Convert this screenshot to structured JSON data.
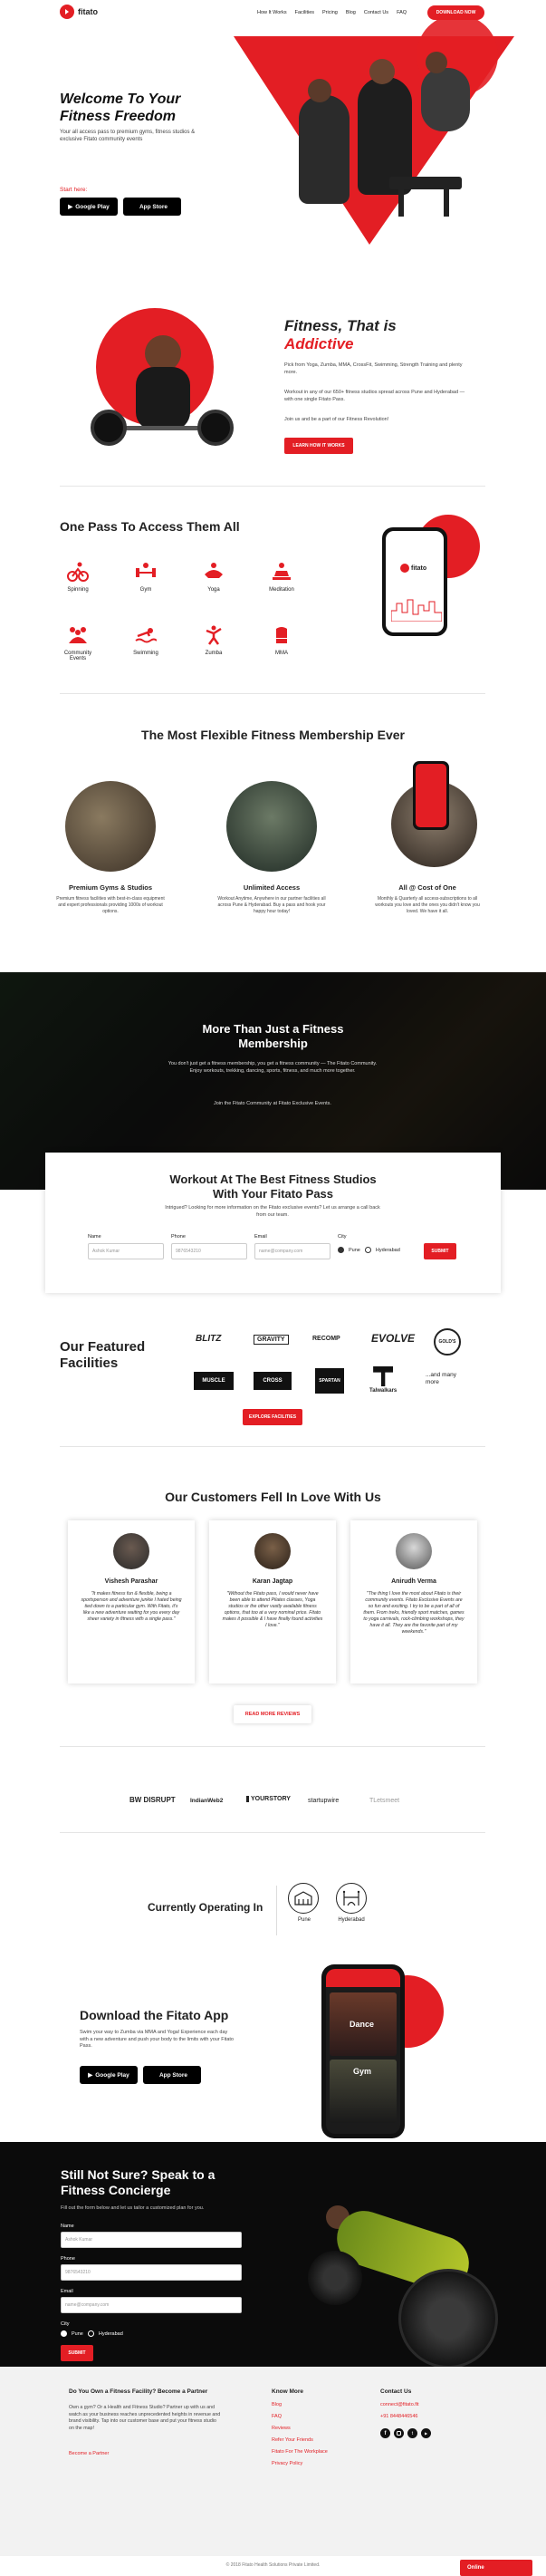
{
  "nav": {
    "brand": "fitato",
    "links": [
      "How It Works",
      "Facilities",
      "Pricing",
      "Blog",
      "Contact Us",
      "FAQ"
    ],
    "cta": "DOWNLOAD NOW"
  },
  "hero": {
    "title_line1": "Welcome To Your",
    "title_line2": "Fitness Freedom",
    "subtitle": "Your all access pass to premium gyms, fitness studios & exclusive Fitato community events",
    "start_here": "Start here:",
    "google_play": "Google Play",
    "app_store": "App Store"
  },
  "addictive": {
    "title_line1": "Fitness, That is",
    "title_line2": "Addictive",
    "p1": "Pick from Yoga, Zumba, MMA, CrossFit, Swimming, Strength Training and plenty more.",
    "p2": "Workout in any of our 650+ fitness studios spread across Pune and Hyderabad — with one single Fitato Pass.",
    "p3": "Join us and be a part of our Fitness Revolution!",
    "cta": "LEARN HOW IT WORKS"
  },
  "onepass": {
    "title": "One Pass To Access Them All",
    "activities": [
      "Spinning",
      "Gym",
      "Yoga",
      "Meditation",
      "Community Events",
      "Swimming",
      "Zumba",
      "MMA"
    ]
  },
  "flexible": {
    "title": "The Most Flexible Fitness Membership Ever",
    "cols": [
      {
        "title": "Premium Gyms & Studios",
        "text": "Premium fitness facilities with best-in-class equipment and expert professionals providing 1000s of workout options."
      },
      {
        "title": "Unlimited Access",
        "text": "Workout Anytime, Anywhere in our partner facilities all across Pune & Hyderabad. Buy a pass and hook your happy hour today!"
      },
      {
        "title": "All @ Cost of One",
        "text": "Monthly & Quarterly all access-subscriptions to all workouts you love and the ones you didn't know you loved. We have it all."
      }
    ]
  },
  "membership": {
    "title_line1": "More Than Just a Fitness",
    "title_line2": "Membership",
    "text": "You don't just get a fitness membership, you get a fitness community — The Fitato Community. Enjoy workouts, trekking, dancing, sports, fitness, and much more together.",
    "text2": "Join the Fitato Community at Fitato Exclusive Events."
  },
  "form1": {
    "title_line1": "Workout At The Best Fitness Studios",
    "title_line2": "With Your Fitato Pass",
    "subtitle": "Intrigued? Looking for more information on the Fitato exclusive events? Let us arrange a call back from our team.",
    "name_label": "Name",
    "name_ph": "Ashok Kumar",
    "phone_label": "Phone",
    "phone_ph": "9876543210",
    "email_label": "Email",
    "email_ph": "name@company.com",
    "city_label": "City",
    "city1": "Pune",
    "city2": "Hyderabad",
    "submit": "SUBMIT"
  },
  "facilities": {
    "title_line1": "Our Featured",
    "title_line2": "Facilities",
    "logos": [
      "BLITZ",
      "GRAVITY",
      "RECOMP",
      "EVOLVE",
      "GOLD'S",
      "MUSCLE",
      "CROSS",
      "SPARTAN",
      "Talwalkars"
    ],
    "more": "...and many more",
    "cta": "EXPLORE FACILITIES"
  },
  "reviews": {
    "title": "Our Customers Fell In Love With Us",
    "items": [
      {
        "name": "Vishesh Parashar",
        "text": "\"It makes fitness fun & flexible, being a sportsperson and adventure junkie I hated being tied down to a particular gym. With Fitato, it's like a new adventure waiting for you every day sheer variety in fitness with a single pass.\""
      },
      {
        "name": "Karan Jagtap",
        "text": "\"Without the Fitato pass, I would never have been able to attend Pilates classes, Yoga studios or the other vastly available fitness options, that too at a very nominal price. Fitato makes it possible & I have finally found activities I love.\""
      },
      {
        "name": "Anirudh Verma",
        "text": "\"The thing I love the most about Fitato is their community events. Fitato Exclusive Events are so fun and exciting. I try to be a part of all of them. From treks, friendly sport matches, games to yoga carnivals, rock-climbing workshops, they have it all. They are the favorite part of my weekends.\""
      }
    ],
    "cta": "READ MORE REVIEWS"
  },
  "press": [
    "BW DISRUPT",
    "IndianWeb2",
    "YOURSTORY",
    "startupwire",
    "TLetsmeet"
  ],
  "cities": {
    "title": "Currently Operating In",
    "items": [
      "Pune",
      "Hyderabad"
    ]
  },
  "download": {
    "title": "Download the Fitato App",
    "text": "Swim your way to Zumba via MMA and Yoga! Experience each day with a new adventure and push your body to the limits with your Fitato Pass.",
    "google_play": "Google Play",
    "app_store": "App Store",
    "phone_item1": "Dance",
    "phone_item2": "Gym"
  },
  "concierge": {
    "title_line1": "Still Not Sure? Speak to a",
    "title_line2": "Fitness Concierge",
    "subtitle": "Fill out the form below and let us tailor a customized plan for you.",
    "name_label": "Name",
    "name_ph": "Ashok Kumar",
    "phone_label": "Phone",
    "phone_ph": "9876543210",
    "email_label": "Email",
    "email_ph": "name@company.com",
    "city_label": "City",
    "city1": "Pune",
    "city2": "Hyderabad",
    "submit": "SUBMIT"
  },
  "footer": {
    "partner_title": "Do You Own a Fitness Facility? Become a Partner",
    "partner_text": "Own a gym? Or a Health and Fitness Studio? Partner up with us and watch as your business reaches unprecedented heights in revenue and brand visibility. Tap into our customer base and put your fitness studio on the map!",
    "partner_link": "Become a Partner",
    "know_title": "Know More",
    "know_links": [
      "Blog",
      "FAQ",
      "Reviews",
      "Refer Your Friends",
      "Fitato For The Workplace",
      "Privacy Policy"
    ],
    "contact_title": "Contact Us",
    "email": "connect@fitato.fit",
    "phone": "+91 8448446546",
    "copyright": "© 2018 Fitato Health Solutions Private Limited.",
    "online": "Online"
  },
  "colors": {
    "accent": "#e31e24",
    "dark": "#0b0b0b",
    "footer_bg": "#f2f2f2"
  }
}
